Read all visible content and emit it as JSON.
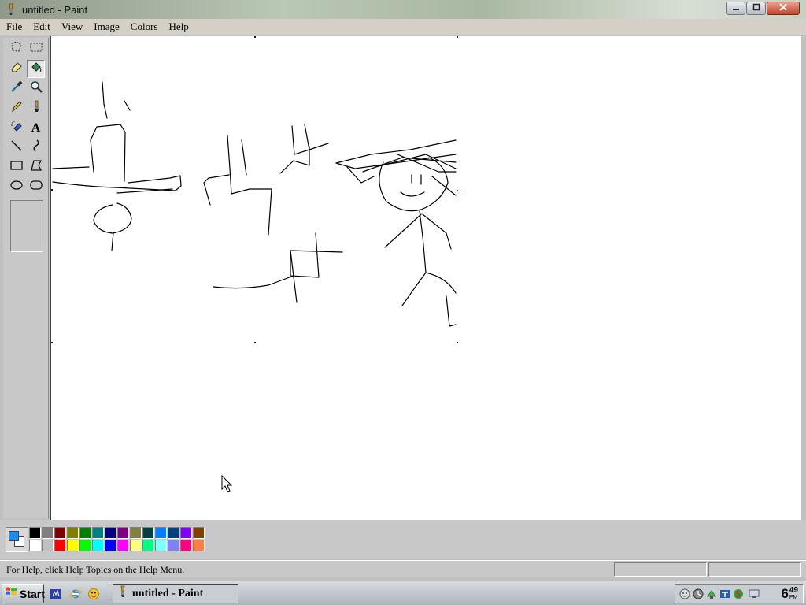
{
  "window": {
    "title": "untitled - Paint",
    "app_icon": "paint-brush-icon",
    "controls": [
      "minimize-icon",
      "maximize-icon",
      "close-icon"
    ]
  },
  "menu": {
    "items": [
      "File",
      "Edit",
      "View",
      "Image",
      "Colors",
      "Help"
    ]
  },
  "tools": [
    {
      "name": "free-form-select",
      "icon": "free-select-icon",
      "active": false
    },
    {
      "name": "rectangle-select",
      "icon": "rect-select-icon",
      "active": false
    },
    {
      "name": "eraser",
      "icon": "eraser-icon",
      "active": false
    },
    {
      "name": "fill-with-color",
      "icon": "fill-bucket-icon",
      "active": true
    },
    {
      "name": "pick-color",
      "icon": "color-picker-icon",
      "active": false
    },
    {
      "name": "magnifier",
      "icon": "magnifier-icon",
      "active": false
    },
    {
      "name": "pencil",
      "icon": "pencil-icon",
      "active": false
    },
    {
      "name": "brush",
      "icon": "brush-icon",
      "active": false
    },
    {
      "name": "airbrush",
      "icon": "airbrush-icon",
      "active": false
    },
    {
      "name": "text",
      "icon": "text-icon",
      "label": "A",
      "active": false
    },
    {
      "name": "line",
      "icon": "line-icon",
      "active": false
    },
    {
      "name": "curve",
      "icon": "curve-icon",
      "active": false
    },
    {
      "name": "rectangle",
      "icon": "rectangle-icon",
      "active": false
    },
    {
      "name": "polygon",
      "icon": "polygon-icon",
      "active": false
    },
    {
      "name": "ellipse",
      "icon": "ellipse-icon",
      "active": false
    },
    {
      "name": "rounded-rectangle",
      "icon": "rounded-rect-icon",
      "active": false
    }
  ],
  "current_colors": {
    "foreground": "#1e8cf0",
    "background": "#ffffff"
  },
  "palette": [
    "#000000",
    "#808080",
    "#800000",
    "#808000",
    "#008000",
    "#008080",
    "#000080",
    "#800080",
    "#808040",
    "#004040",
    "#0080ff",
    "#004080",
    "#8000ff",
    "#804000",
    "#ffffff",
    "#c0c0c0",
    "#ff0000",
    "#ffff00",
    "#00ff00",
    "#00ffff",
    "#0000ff",
    "#ff00ff",
    "#ffff80",
    "#00ff80",
    "#80ffff",
    "#8080ff",
    "#ff0080",
    "#ff8040"
  ],
  "status": {
    "help_text": "For Help, click Help Topics on the Help Menu."
  },
  "taskbar": {
    "start_label": "Start",
    "start_icon": "windows-flag-icon",
    "quick_launch": [
      "media-icon",
      "internet-explorer-icon",
      "messenger-icon"
    ],
    "task_button_label": "untitled - Paint",
    "task_button_icon": "paint-brush-icon",
    "tray_icons": [
      "smiley-icon",
      "shield-icon",
      "network-icon",
      "tray-app-icon",
      "security-icon",
      "display-icon"
    ],
    "clock": {
      "hour": "6",
      "minutes": "49",
      "ampm": "PM"
    }
  },
  "cursor": "arrow-cursor-icon"
}
